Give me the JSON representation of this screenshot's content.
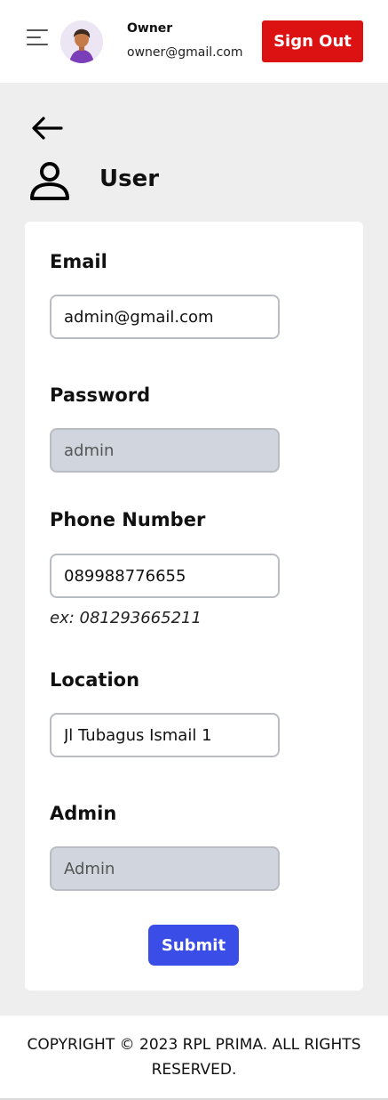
{
  "header": {
    "user_name": "Owner",
    "user_email": "owner@gmail.com",
    "signout_label": "Sign Out",
    "signout_color": "#dc1212"
  },
  "page": {
    "title": "User",
    "icon": "user-outline-icon"
  },
  "form": {
    "email": {
      "label": "Email",
      "value": "admin@gmail.com"
    },
    "password": {
      "label": "Password",
      "value": "admin"
    },
    "phone": {
      "label": "Phone Number",
      "value": "089988776655",
      "hint": "ex: 081293665211"
    },
    "location": {
      "label": "Location",
      "value": "Jl Tubagus Ismail 1"
    },
    "admin": {
      "label": "Admin",
      "value": "Admin"
    },
    "submit_label": "Submit",
    "submit_color": "#3a4de6"
  },
  "footer": {
    "copyright": "COPYRIGHT © 2023 RPL PRIMA. ALL RIGHTS RESERVED."
  }
}
